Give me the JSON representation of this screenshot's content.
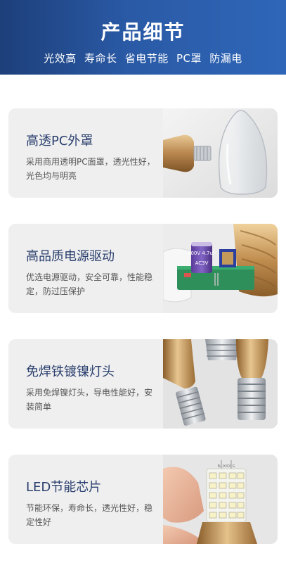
{
  "banner": {
    "title": "产品细节",
    "subtitle": "光效高 寿命长 省电节能 PC罩 防漏电"
  },
  "cards": [
    {
      "title": "高透PC外罩",
      "description": "采用商用透明PC面罩，透光性好，光色均与明亮",
      "photo": "clear-pc-cover-photo"
    },
    {
      "title": "高品质电源驱动",
      "description": "优选电源驱动，安全可靠，性能稳定，防过压保护",
      "photo": "power-driver-board-photo"
    },
    {
      "title": "免焊铁镀镍灯头",
      "description": "采用免焊镍灯头，导电性能好，安装简单",
      "photo": "nickel-lamp-base-photo"
    },
    {
      "title": "LED节能芯片",
      "description": "节能环保，寿命长，透光性好，稳定性好",
      "photo": "led-chip-photo",
      "chip_marking": "BAIXIONG"
    }
  ],
  "board_labels": {
    "capacitor": "400V 4.7uF",
    "capacitor_code": "AC3V"
  },
  "colors": {
    "banner_dark": "#1d3f7a",
    "banner_light": "#2f66b8",
    "card_bg": "#efefef",
    "title_text": "#2a3f6e",
    "gold": "#c8a06a"
  }
}
